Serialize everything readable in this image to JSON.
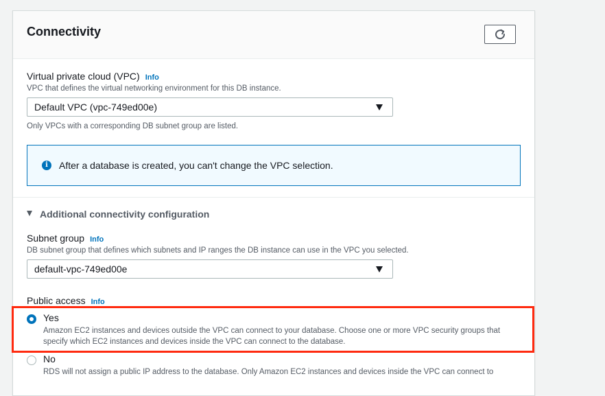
{
  "panel": {
    "title": "Connectivity"
  },
  "refresh": {
    "icon": "refresh-icon"
  },
  "vpc": {
    "label": "Virtual private cloud (VPC)",
    "info": "Info",
    "description": "VPC that defines the virtual networking environment for this DB instance.",
    "selected": "Default VPC (vpc-749ed00e)",
    "hint": "Only VPCs with a corresponding DB subnet group are listed."
  },
  "alert": {
    "icon": "info-circle-icon",
    "text": "After a database is created, you can't change the VPC selection.",
    "border_color": "#0073bb",
    "background": "#f1faff"
  },
  "additional": {
    "label": "Additional connectivity configuration"
  },
  "subnet": {
    "label": "Subnet group",
    "info": "Info",
    "description": "DB subnet group that defines which subnets and IP ranges the DB instance can use in the VPC you selected.",
    "selected": "default-vpc-749ed00e"
  },
  "public_access": {
    "label": "Public access",
    "info": "Info",
    "selected": "Yes",
    "options": [
      {
        "label": "Yes",
        "description_line1": "Amazon EC2 instances and devices outside the VPC can connect to your database. Choose one or more VPC security groups that",
        "description_line2": "specify which EC2 instances and devices inside the VPC can connect to the database."
      },
      {
        "label": "No",
        "description_line1": "RDS will not assign a public IP address to the database. Only Amazon EC2 instances and devices inside the VPC can connect to"
      }
    ]
  },
  "colors": {
    "accent": "#0073bb",
    "highlight": "#ff2a0f"
  }
}
